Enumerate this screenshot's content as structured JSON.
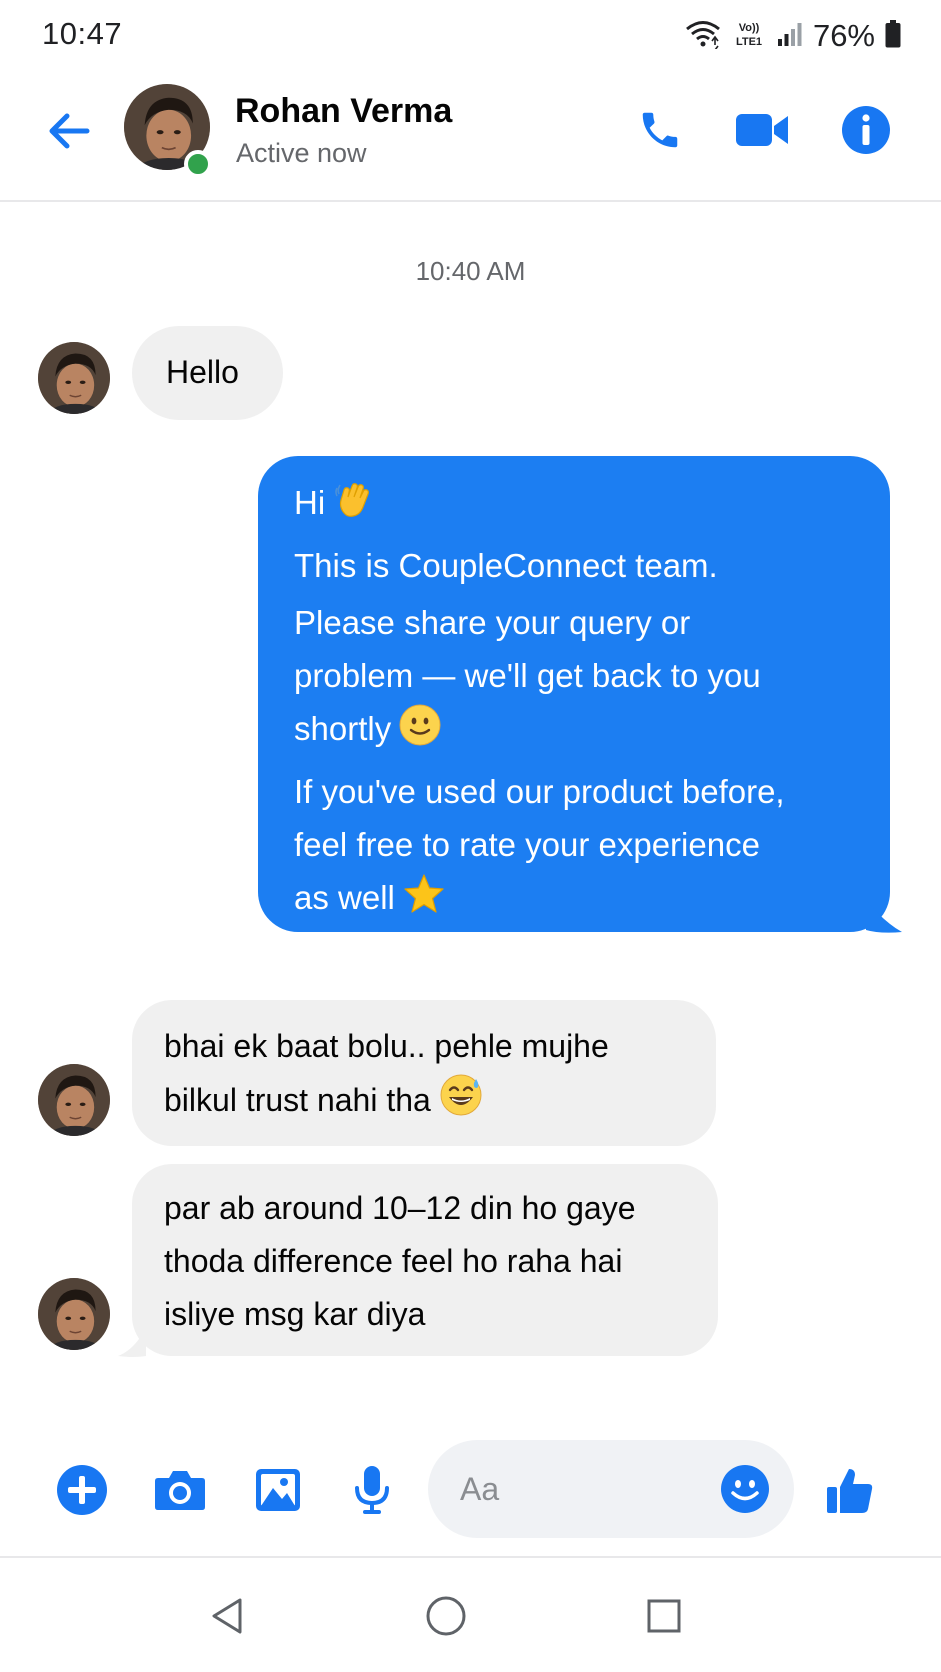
{
  "status_bar": {
    "time": "10:47",
    "network_label": "Vo)) LTE1",
    "battery": "76%"
  },
  "header": {
    "contact_name": "Rohan Verma",
    "contact_status": "Active now",
    "icons": [
      "back-arrow-icon",
      "phone-icon",
      "video-camera-icon",
      "info-icon"
    ]
  },
  "chat": {
    "timestamp": "10:40 AM",
    "messages": [
      {
        "direction": "incoming",
        "lines": [
          "Hello"
        ]
      },
      {
        "direction": "outgoing",
        "lines": [
          "Hi",
          "This is CoupleConnect team.",
          "Please share your query or",
          "problem — we'll get back to you",
          "shortly",
          "If you've used our product before,",
          "feel free to rate your experience",
          "as well"
        ],
        "emojis": [
          "waving-hand",
          "slightly-smiling-face",
          "star"
        ]
      },
      {
        "direction": "incoming",
        "lines": [
          "bhai ek baat bolu.. pehle mujhe",
          "bilkul trust nahi tha"
        ],
        "emojis": [
          "grinning-face-with-sweat"
        ]
      },
      {
        "direction": "incoming",
        "lines": [
          "par ab around 10–12 din ho gaye",
          "thoda difference feel ho raha hai",
          "isliye msg kar diya"
        ]
      }
    ]
  },
  "composer": {
    "placeholder": "Aa",
    "value": "",
    "icons": [
      "plus-icon",
      "camera-icon",
      "gallery-icon",
      "microphone-icon",
      "emoji-icon",
      "thumbs-up-icon"
    ]
  },
  "nav": {
    "icons": [
      "nav-back-icon",
      "nav-home-icon",
      "nav-recents-icon"
    ]
  },
  "colors": {
    "accent": "#1c7ef2",
    "icon_blue": "#1877f2",
    "incoming_bubble": "#f0f0f0",
    "online": "#31a24c"
  }
}
